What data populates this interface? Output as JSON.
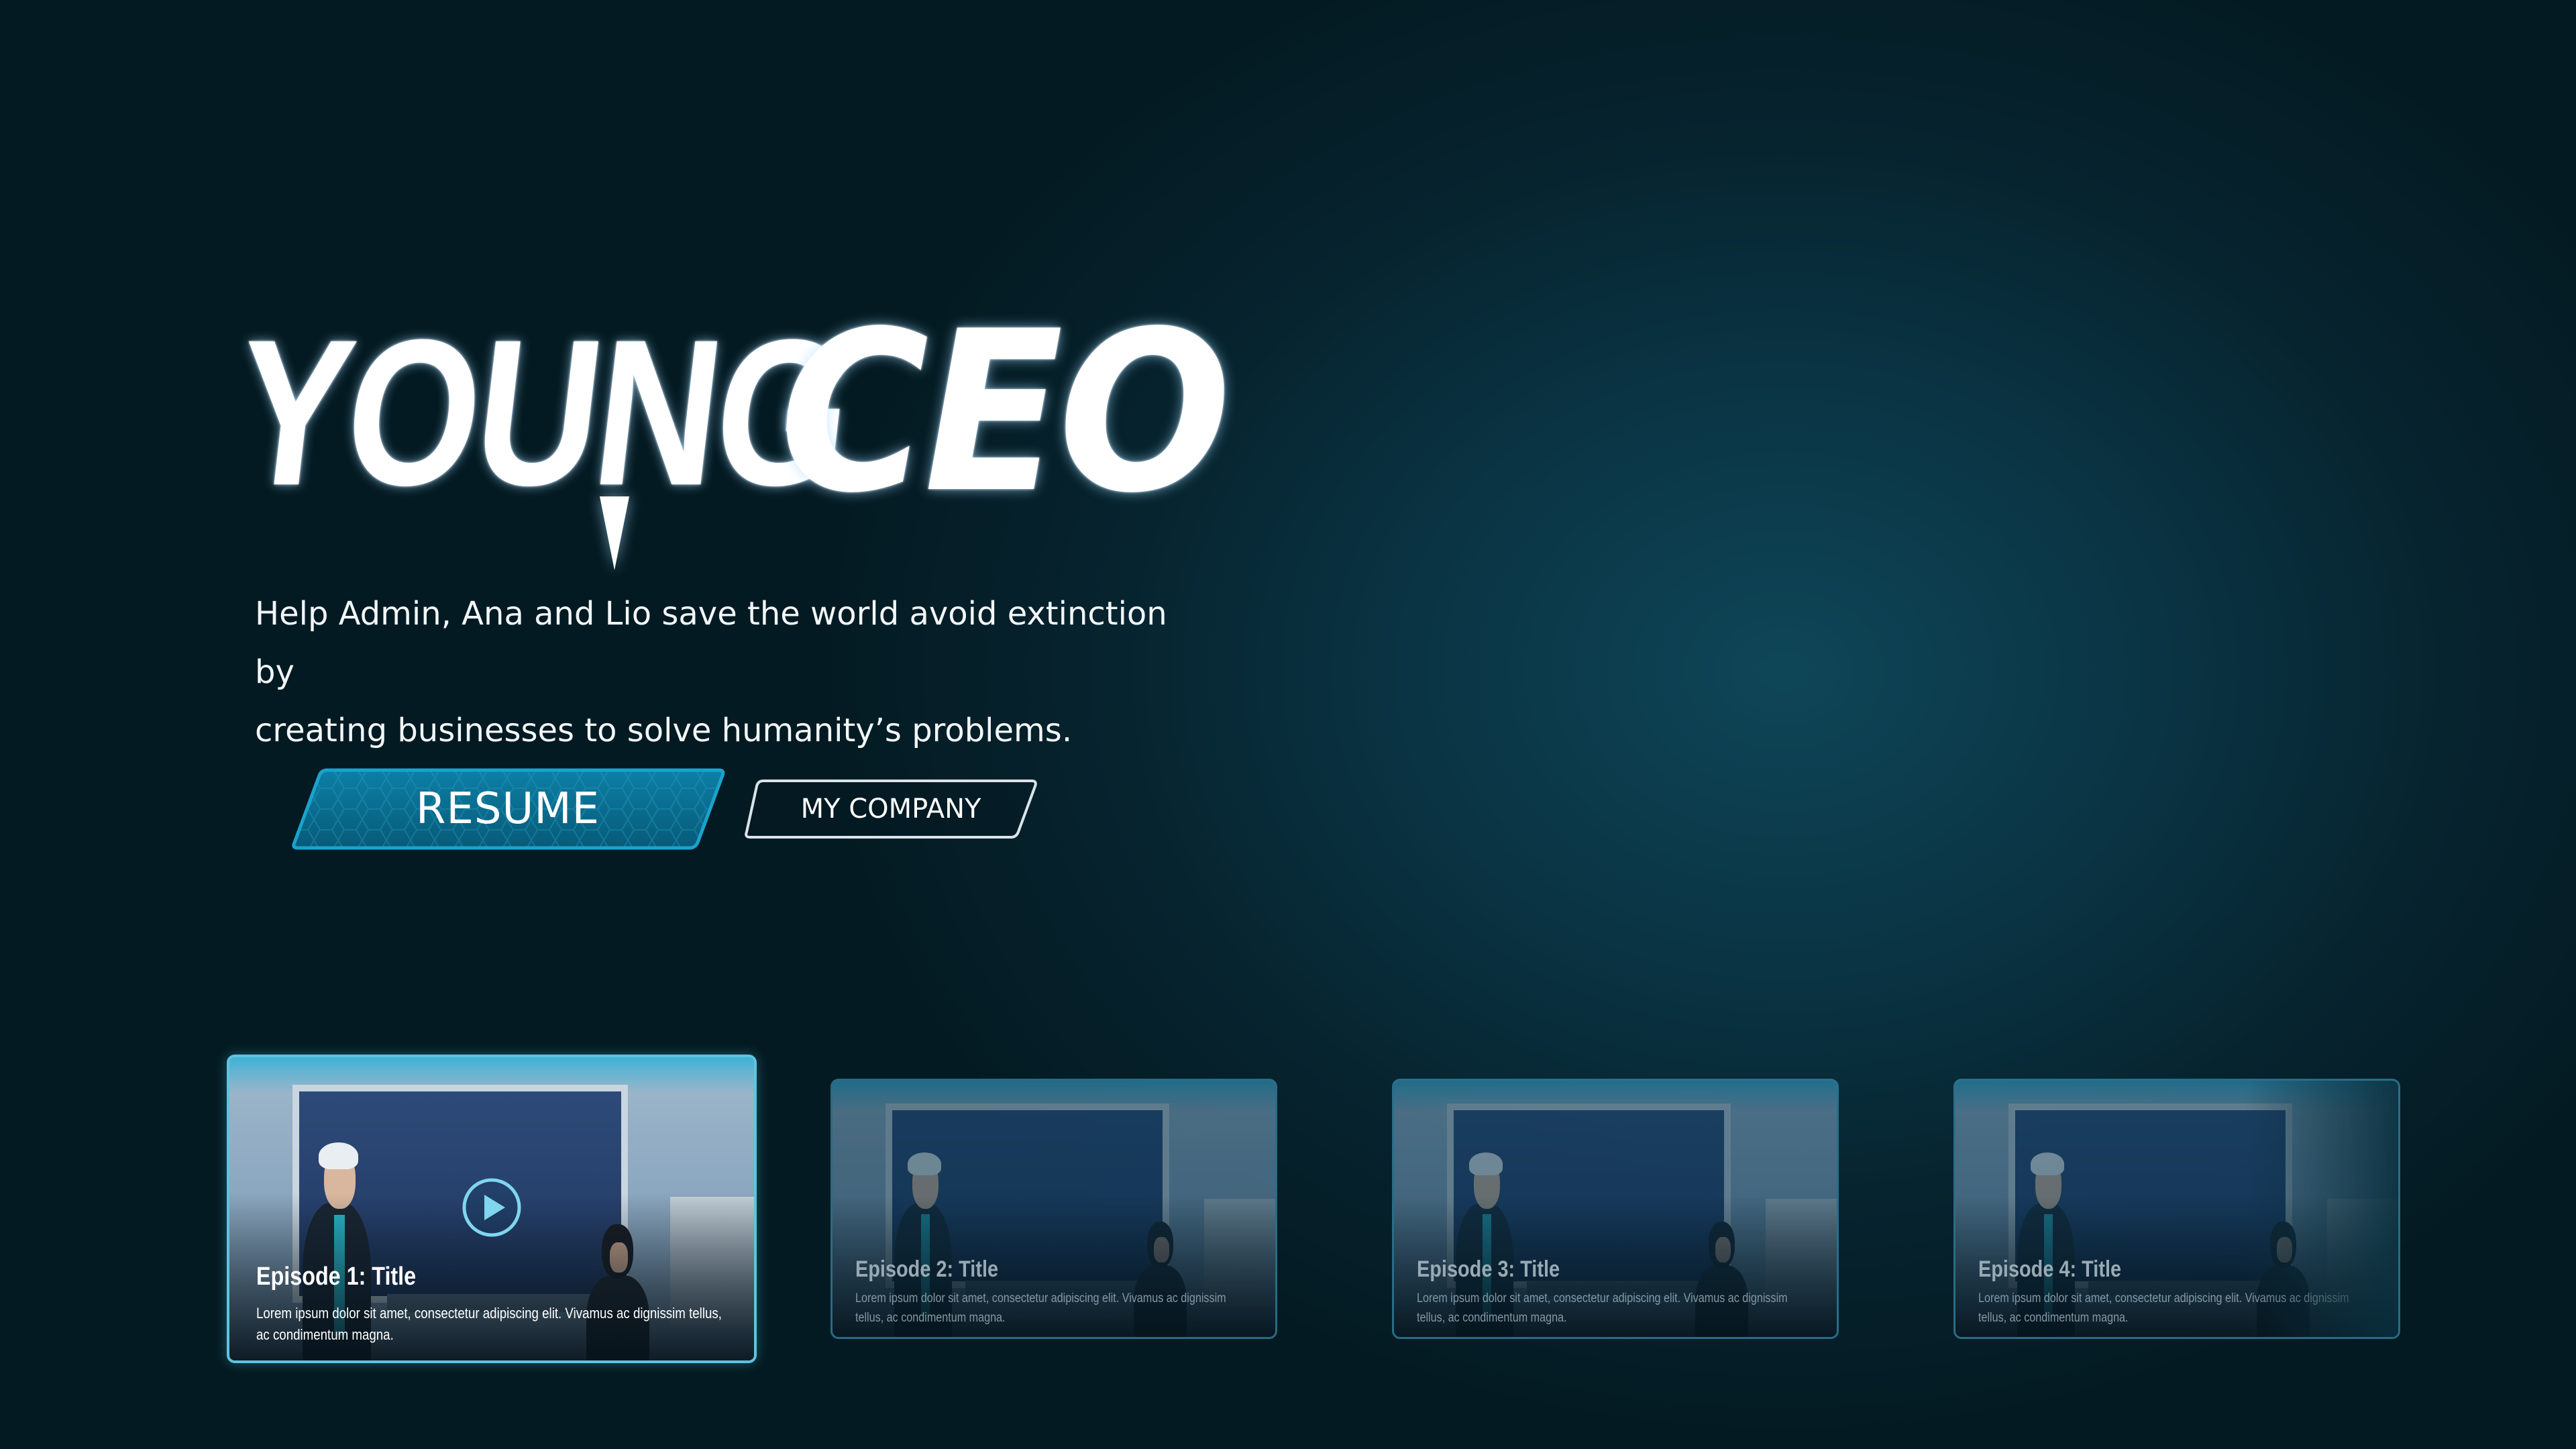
{
  "logo": {
    "word_young": "YOUNG",
    "word_ceo": "CEO"
  },
  "description": {
    "line1": "Help Admin, Ana and Lio save the world avoid extinction by",
    "line2": "creating businesses to solve humanity’s problems."
  },
  "buttons": {
    "resume_label": "RESUME",
    "company_label": "MY COMPANY"
  },
  "episodes": [
    {
      "title": "Episode 1: Title",
      "description": "Lorem ipsum dolor sit amet, consectetur adipiscing elit. Vivamus ac dignissim tellus, ac condimentum magna.",
      "selected": true,
      "icon": "play-icon"
    },
    {
      "title": "Episode 2: Title",
      "description": "Lorem ipsum dolor sit amet, consectetur adipiscing elit. Vivamus ac dignissim tellus, ac condimentum magna.",
      "selected": false
    },
    {
      "title": "Episode 3: Title",
      "description": "Lorem ipsum dolor sit amet, consectetur adipiscing elit. Vivamus ac dignissim tellus, ac condimentum magna.",
      "selected": false
    },
    {
      "title": "Episode 4: Title",
      "description": "Lorem ipsum dolor sit amet, consectetur adipiscing elit. Vivamus ac dignissim tellus, ac condimentum magna.",
      "selected": false
    }
  ],
  "colors": {
    "background": "#06232e",
    "accent": "#5ec4e0",
    "resume_fill": "#0a6f91",
    "resume_border": "#1aa3cc"
  }
}
